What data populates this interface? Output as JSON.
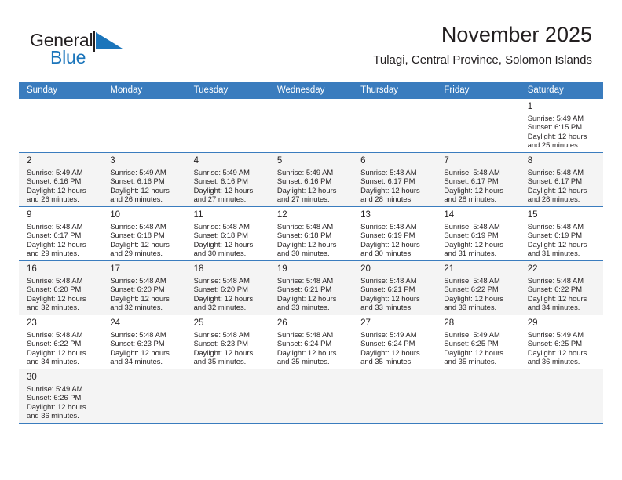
{
  "brand": {
    "name_part1": "General",
    "name_part2": "Blue",
    "flag_color": "#1b75bb"
  },
  "header": {
    "title": "November 2025",
    "subtitle": "Tulagi, Central Province, Solomon Islands"
  },
  "theme": {
    "header_row_bg": "#3a7cbe",
    "shaded_row_bg": "#f4f4f4",
    "grid_line": "#3a7cbe"
  },
  "labels": {
    "sunrise_prefix": "Sunrise:",
    "sunset_prefix": "Sunset:",
    "daylight_prefix": "Daylight:"
  },
  "weekdays": [
    "Sunday",
    "Monday",
    "Tuesday",
    "Wednesday",
    "Thursday",
    "Friday",
    "Saturday"
  ],
  "weeks": [
    [
      {
        "day": "",
        "info": ""
      },
      {
        "day": "",
        "info": ""
      },
      {
        "day": "",
        "info": ""
      },
      {
        "day": "",
        "info": ""
      },
      {
        "day": "",
        "info": ""
      },
      {
        "day": "",
        "info": ""
      },
      {
        "day": "1",
        "info": "Sunrise: 5:49 AM\nSunset: 6:15 PM\nDaylight: 12 hours\nand 25 minutes."
      }
    ],
    [
      {
        "day": "2",
        "info": "Sunrise: 5:49 AM\nSunset: 6:16 PM\nDaylight: 12 hours\nand 26 minutes."
      },
      {
        "day": "3",
        "info": "Sunrise: 5:49 AM\nSunset: 6:16 PM\nDaylight: 12 hours\nand 26 minutes."
      },
      {
        "day": "4",
        "info": "Sunrise: 5:49 AM\nSunset: 6:16 PM\nDaylight: 12 hours\nand 27 minutes."
      },
      {
        "day": "5",
        "info": "Sunrise: 5:49 AM\nSunset: 6:16 PM\nDaylight: 12 hours\nand 27 minutes."
      },
      {
        "day": "6",
        "info": "Sunrise: 5:48 AM\nSunset: 6:17 PM\nDaylight: 12 hours\nand 28 minutes."
      },
      {
        "day": "7",
        "info": "Sunrise: 5:48 AM\nSunset: 6:17 PM\nDaylight: 12 hours\nand 28 minutes."
      },
      {
        "day": "8",
        "info": "Sunrise: 5:48 AM\nSunset: 6:17 PM\nDaylight: 12 hours\nand 28 minutes."
      }
    ],
    [
      {
        "day": "9",
        "info": "Sunrise: 5:48 AM\nSunset: 6:17 PM\nDaylight: 12 hours\nand 29 minutes."
      },
      {
        "day": "10",
        "info": "Sunrise: 5:48 AM\nSunset: 6:18 PM\nDaylight: 12 hours\nand 29 minutes."
      },
      {
        "day": "11",
        "info": "Sunrise: 5:48 AM\nSunset: 6:18 PM\nDaylight: 12 hours\nand 30 minutes."
      },
      {
        "day": "12",
        "info": "Sunrise: 5:48 AM\nSunset: 6:18 PM\nDaylight: 12 hours\nand 30 minutes."
      },
      {
        "day": "13",
        "info": "Sunrise: 5:48 AM\nSunset: 6:19 PM\nDaylight: 12 hours\nand 30 minutes."
      },
      {
        "day": "14",
        "info": "Sunrise: 5:48 AM\nSunset: 6:19 PM\nDaylight: 12 hours\nand 31 minutes."
      },
      {
        "day": "15",
        "info": "Sunrise: 5:48 AM\nSunset: 6:19 PM\nDaylight: 12 hours\nand 31 minutes."
      }
    ],
    [
      {
        "day": "16",
        "info": "Sunrise: 5:48 AM\nSunset: 6:20 PM\nDaylight: 12 hours\nand 32 minutes."
      },
      {
        "day": "17",
        "info": "Sunrise: 5:48 AM\nSunset: 6:20 PM\nDaylight: 12 hours\nand 32 minutes."
      },
      {
        "day": "18",
        "info": "Sunrise: 5:48 AM\nSunset: 6:20 PM\nDaylight: 12 hours\nand 32 minutes."
      },
      {
        "day": "19",
        "info": "Sunrise: 5:48 AM\nSunset: 6:21 PM\nDaylight: 12 hours\nand 33 minutes."
      },
      {
        "day": "20",
        "info": "Sunrise: 5:48 AM\nSunset: 6:21 PM\nDaylight: 12 hours\nand 33 minutes."
      },
      {
        "day": "21",
        "info": "Sunrise: 5:48 AM\nSunset: 6:22 PM\nDaylight: 12 hours\nand 33 minutes."
      },
      {
        "day": "22",
        "info": "Sunrise: 5:48 AM\nSunset: 6:22 PM\nDaylight: 12 hours\nand 34 minutes."
      }
    ],
    [
      {
        "day": "23",
        "info": "Sunrise: 5:48 AM\nSunset: 6:22 PM\nDaylight: 12 hours\nand 34 minutes."
      },
      {
        "day": "24",
        "info": "Sunrise: 5:48 AM\nSunset: 6:23 PM\nDaylight: 12 hours\nand 34 minutes."
      },
      {
        "day": "25",
        "info": "Sunrise: 5:48 AM\nSunset: 6:23 PM\nDaylight: 12 hours\nand 35 minutes."
      },
      {
        "day": "26",
        "info": "Sunrise: 5:48 AM\nSunset: 6:24 PM\nDaylight: 12 hours\nand 35 minutes."
      },
      {
        "day": "27",
        "info": "Sunrise: 5:49 AM\nSunset: 6:24 PM\nDaylight: 12 hours\nand 35 minutes."
      },
      {
        "day": "28",
        "info": "Sunrise: 5:49 AM\nSunset: 6:25 PM\nDaylight: 12 hours\nand 35 minutes."
      },
      {
        "day": "29",
        "info": "Sunrise: 5:49 AM\nSunset: 6:25 PM\nDaylight: 12 hours\nand 36 minutes."
      }
    ],
    [
      {
        "day": "30",
        "info": "Sunrise: 5:49 AM\nSunset: 6:26 PM\nDaylight: 12 hours\nand 36 minutes."
      },
      {
        "day": "",
        "info": ""
      },
      {
        "day": "",
        "info": ""
      },
      {
        "day": "",
        "info": ""
      },
      {
        "day": "",
        "info": ""
      },
      {
        "day": "",
        "info": ""
      },
      {
        "day": "",
        "info": ""
      }
    ]
  ]
}
